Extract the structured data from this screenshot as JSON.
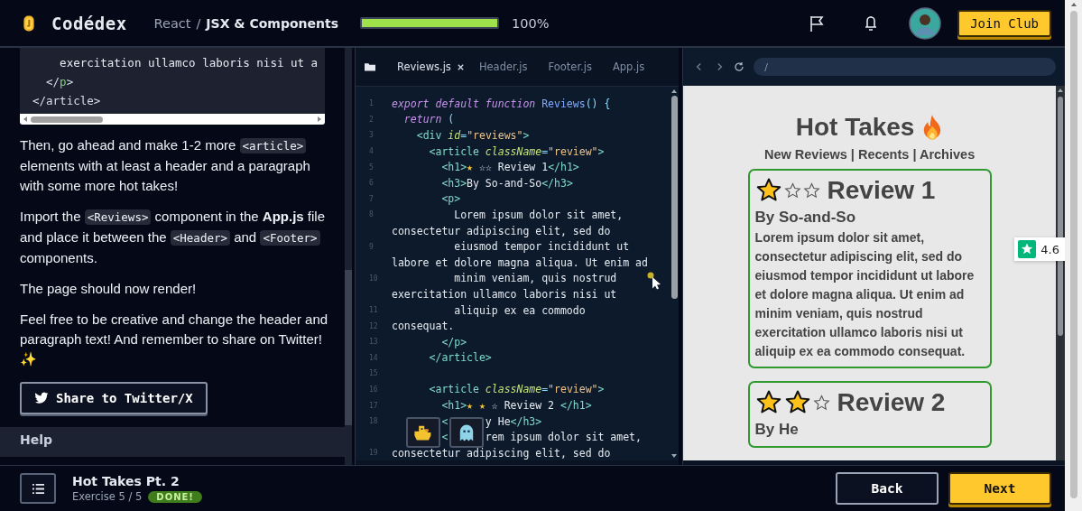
{
  "header": {
    "logo": "Codédex",
    "course": "React",
    "separator": "/",
    "chapter": "JSX & Components",
    "progress": {
      "level": 1,
      "reading": "100%"
    },
    "join_button": "Join Club"
  },
  "lesson": {
    "code_block": [
      [
        {
          "kind": "text",
          "text": "    exercitation ullamco laboris nisi ut a"
        }
      ],
      [
        {
          "kind": "punct",
          "text": "  </"
        },
        {
          "kind": "name",
          "text": "p"
        },
        {
          "kind": "punct",
          "text": ">"
        }
      ],
      [
        {
          "kind": "punct",
          "text": "</article>"
        }
      ]
    ],
    "paragraphs": [
      [
        {
          "kind": "text",
          "text": "Then, go ahead and make 1-2 more "
        },
        {
          "kind": "code",
          "text": "<article>"
        },
        {
          "kind": "text",
          "text": " elements with at least a header and a paragraph with some more hot takes!"
        }
      ],
      [
        {
          "kind": "text",
          "text": "Import the "
        },
        {
          "kind": "code",
          "text": "<Reviews>"
        },
        {
          "kind": "text",
          "text": " component in the "
        },
        {
          "kind": "bold",
          "text": "App.js"
        },
        {
          "kind": "text",
          "text": " file and place it between the "
        },
        {
          "kind": "code",
          "text": "<Header>"
        },
        {
          "kind": "text",
          "text": " and "
        },
        {
          "kind": "code",
          "text": "<Footer>"
        },
        {
          "kind": "text",
          "text": " components."
        }
      ],
      [
        {
          "kind": "text",
          "text": "The page should now render!"
        }
      ],
      [
        {
          "kind": "text",
          "text": "Feel free to be creative and change the header and paragraph text! And remember to share on Twitter! ✨"
        }
      ]
    ],
    "share_button": "Share to Twitter/X",
    "help": "Help"
  },
  "editor": {
    "tabs": [
      {
        "label": "Reviews.js",
        "selected": true
      },
      {
        "label": "Header.js",
        "selected": false
      },
      {
        "label": "Footer.js",
        "selected": false
      },
      {
        "label": "App.js",
        "selected": false
      }
    ],
    "lines": [
      {
        "number": "1",
        "segments": [
          {
            "kind": "kw",
            "text": "export default function "
          },
          {
            "kind": "fn",
            "text": "Reviews"
          },
          {
            "kind": "punct",
            "text": "() {"
          }
        ]
      },
      {
        "number": "2",
        "segments": [
          {
            "kind": "kw",
            "text": "  return "
          },
          {
            "kind": "punct",
            "text": "("
          }
        ]
      },
      {
        "number": "3",
        "segments": [
          {
            "kind": "tag",
            "text": "    <div "
          },
          {
            "kind": "attr",
            "text": "id"
          },
          {
            "kind": "punct",
            "text": "="
          },
          {
            "kind": "str",
            "text": "\"reviews\""
          },
          {
            "kind": "tag",
            "text": ">"
          }
        ]
      },
      {
        "number": "4",
        "segments": [
          {
            "kind": "tag",
            "text": "      <article "
          },
          {
            "kind": "attr",
            "text": "className"
          },
          {
            "kind": "punct",
            "text": "="
          },
          {
            "kind": "str",
            "text": "\"review\""
          },
          {
            "kind": "tag",
            "text": ">"
          }
        ]
      },
      {
        "number": "5",
        "segments": [
          {
            "kind": "tag",
            "text": "        <h1>"
          },
          {
            "kind": "star",
            "text": "★"
          },
          {
            "kind": "text",
            "text": " ☆☆ Review 1"
          },
          {
            "kind": "tag",
            "text": "</h1>"
          }
        ]
      },
      {
        "number": "6",
        "segments": [
          {
            "kind": "tag",
            "text": "        <h3>"
          },
          {
            "kind": "text",
            "text": "By So-and-So"
          },
          {
            "kind": "tag",
            "text": "</h3>"
          }
        ]
      },
      {
        "number": "7",
        "segments": [
          {
            "kind": "tag",
            "text": "        <p>"
          }
        ]
      },
      {
        "number": "8",
        "segments": [
          {
            "kind": "text",
            "text": "          Lorem ipsum dolor sit amet,"
          }
        ]
      },
      {
        "segments": [
          {
            "kind": "text",
            "text": "consectetur adipiscing elit, sed do"
          }
        ]
      },
      {
        "number": "9",
        "segments": [
          {
            "kind": "text",
            "text": "          eiusmod tempor incididunt ut"
          }
        ]
      },
      {
        "segments": [
          {
            "kind": "text",
            "text": "labore et dolore magna aliqua. Ut enim ad"
          }
        ]
      },
      {
        "number": "10",
        "segments": [
          {
            "kind": "text",
            "text": "          minim veniam, quis nostrud"
          }
        ]
      },
      {
        "segments": [
          {
            "kind": "text",
            "text": "exercitation ullamco laboris nisi ut"
          }
        ]
      },
      {
        "number": "11",
        "segments": [
          {
            "kind": "text",
            "text": "          aliquip ex ea commodo"
          }
        ]
      },
      {
        "number": "12",
        "segments": [
          {
            "kind": "text",
            "text": "consequat."
          }
        ]
      },
      {
        "number": "13",
        "segments": [
          {
            "kind": "tag",
            "text": "        </p>"
          }
        ]
      },
      {
        "number": "14",
        "segments": [
          {
            "kind": "tag",
            "text": "      </article>"
          }
        ]
      },
      {
        "number": "15"
      },
      {
        "number": "16",
        "segments": [
          {
            "kind": "tag",
            "text": "      <article "
          },
          {
            "kind": "attr",
            "text": "className"
          },
          {
            "kind": "punct",
            "text": "="
          },
          {
            "kind": "str",
            "text": "\"review\""
          },
          {
            "kind": "tag",
            "text": ">"
          }
        ]
      },
      {
        "number": "17",
        "segments": [
          {
            "kind": "tag",
            "text": "        <h1>"
          },
          {
            "kind": "star",
            "text": "★ ★"
          },
          {
            "kind": "text",
            "text": " ☆ Review 2 "
          },
          {
            "kind": "tag",
            "text": "</h1>"
          }
        ]
      },
      {
        "number": "18",
        "segments": [
          {
            "kind": "tag",
            "text": "        <"
          },
          {
            "kind": "resume",
            "text": "y He"
          },
          {
            "kind": "tag",
            "text": "</h3>"
          }
        ]
      },
      {
        "segments": [
          {
            "kind": "tag",
            "text": "        <"
          },
          {
            "kind": "resume",
            "text": "rem ipsum dolor sit amet,"
          }
        ]
      },
      {
        "number": "19",
        "segments": [
          {
            "kind": "text",
            "text": "consectetur adipiscing elit, sed do"
          }
        ]
      }
    ]
  },
  "preview": {
    "url": "/",
    "title": "Hot Takes",
    "nav": "New Reviews | Recents | Archives",
    "reviews": [
      {
        "stars": 1,
        "heading": "Review 1",
        "author": "By So-and-So",
        "body": "Lorem ipsum dolor sit amet, consectetur adipiscing elit, sed do eiusmod tempor incididunt ut labore et dolore magna aliqua. Ut enim ad minim veniam, quis nostrud exercitation ullamco laboris nisi ut aliquip ex ea commodo consequat."
      },
      {
        "stars": 2,
        "heading": "Review 2",
        "author": "By He"
      }
    ],
    "rating": "4.6"
  },
  "footer": {
    "title": "Hot Takes Pt. 2",
    "exercise": "Exercise 5 / 5",
    "status": "DONE!",
    "back": "Back",
    "next": "Next"
  }
}
